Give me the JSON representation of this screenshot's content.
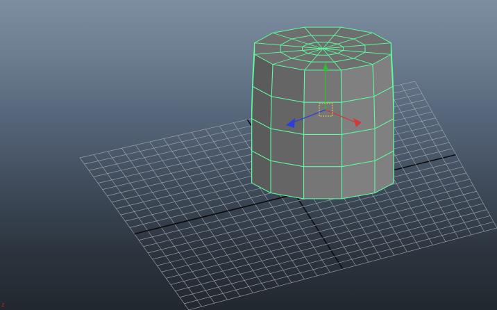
{
  "viewport": {
    "name": "perspective-viewport",
    "background_top": "#7d8ea1",
    "background_bottom": "#22282f"
  },
  "scene": {
    "grid": {
      "visible": true,
      "line_color": "#a9acb0",
      "axis_color": "#0b0b0b"
    },
    "selected_object": {
      "type": "polygon-cylinder",
      "subdivisions_axis": 12,
      "subdivisions_height": 4,
      "subdivisions_caps": 2,
      "wireframe_color": "#5dfc9f",
      "face_color": "#6e6e6e"
    },
    "manipulator": {
      "type": "move-tool",
      "x_color": "#d23a3a",
      "y_color": "#2fbd2f",
      "z_color": "#2d3fd6",
      "center_color": "#e8d54a"
    }
  },
  "view_axis_indicator": {
    "label": "z",
    "color": "#d21e1e"
  }
}
